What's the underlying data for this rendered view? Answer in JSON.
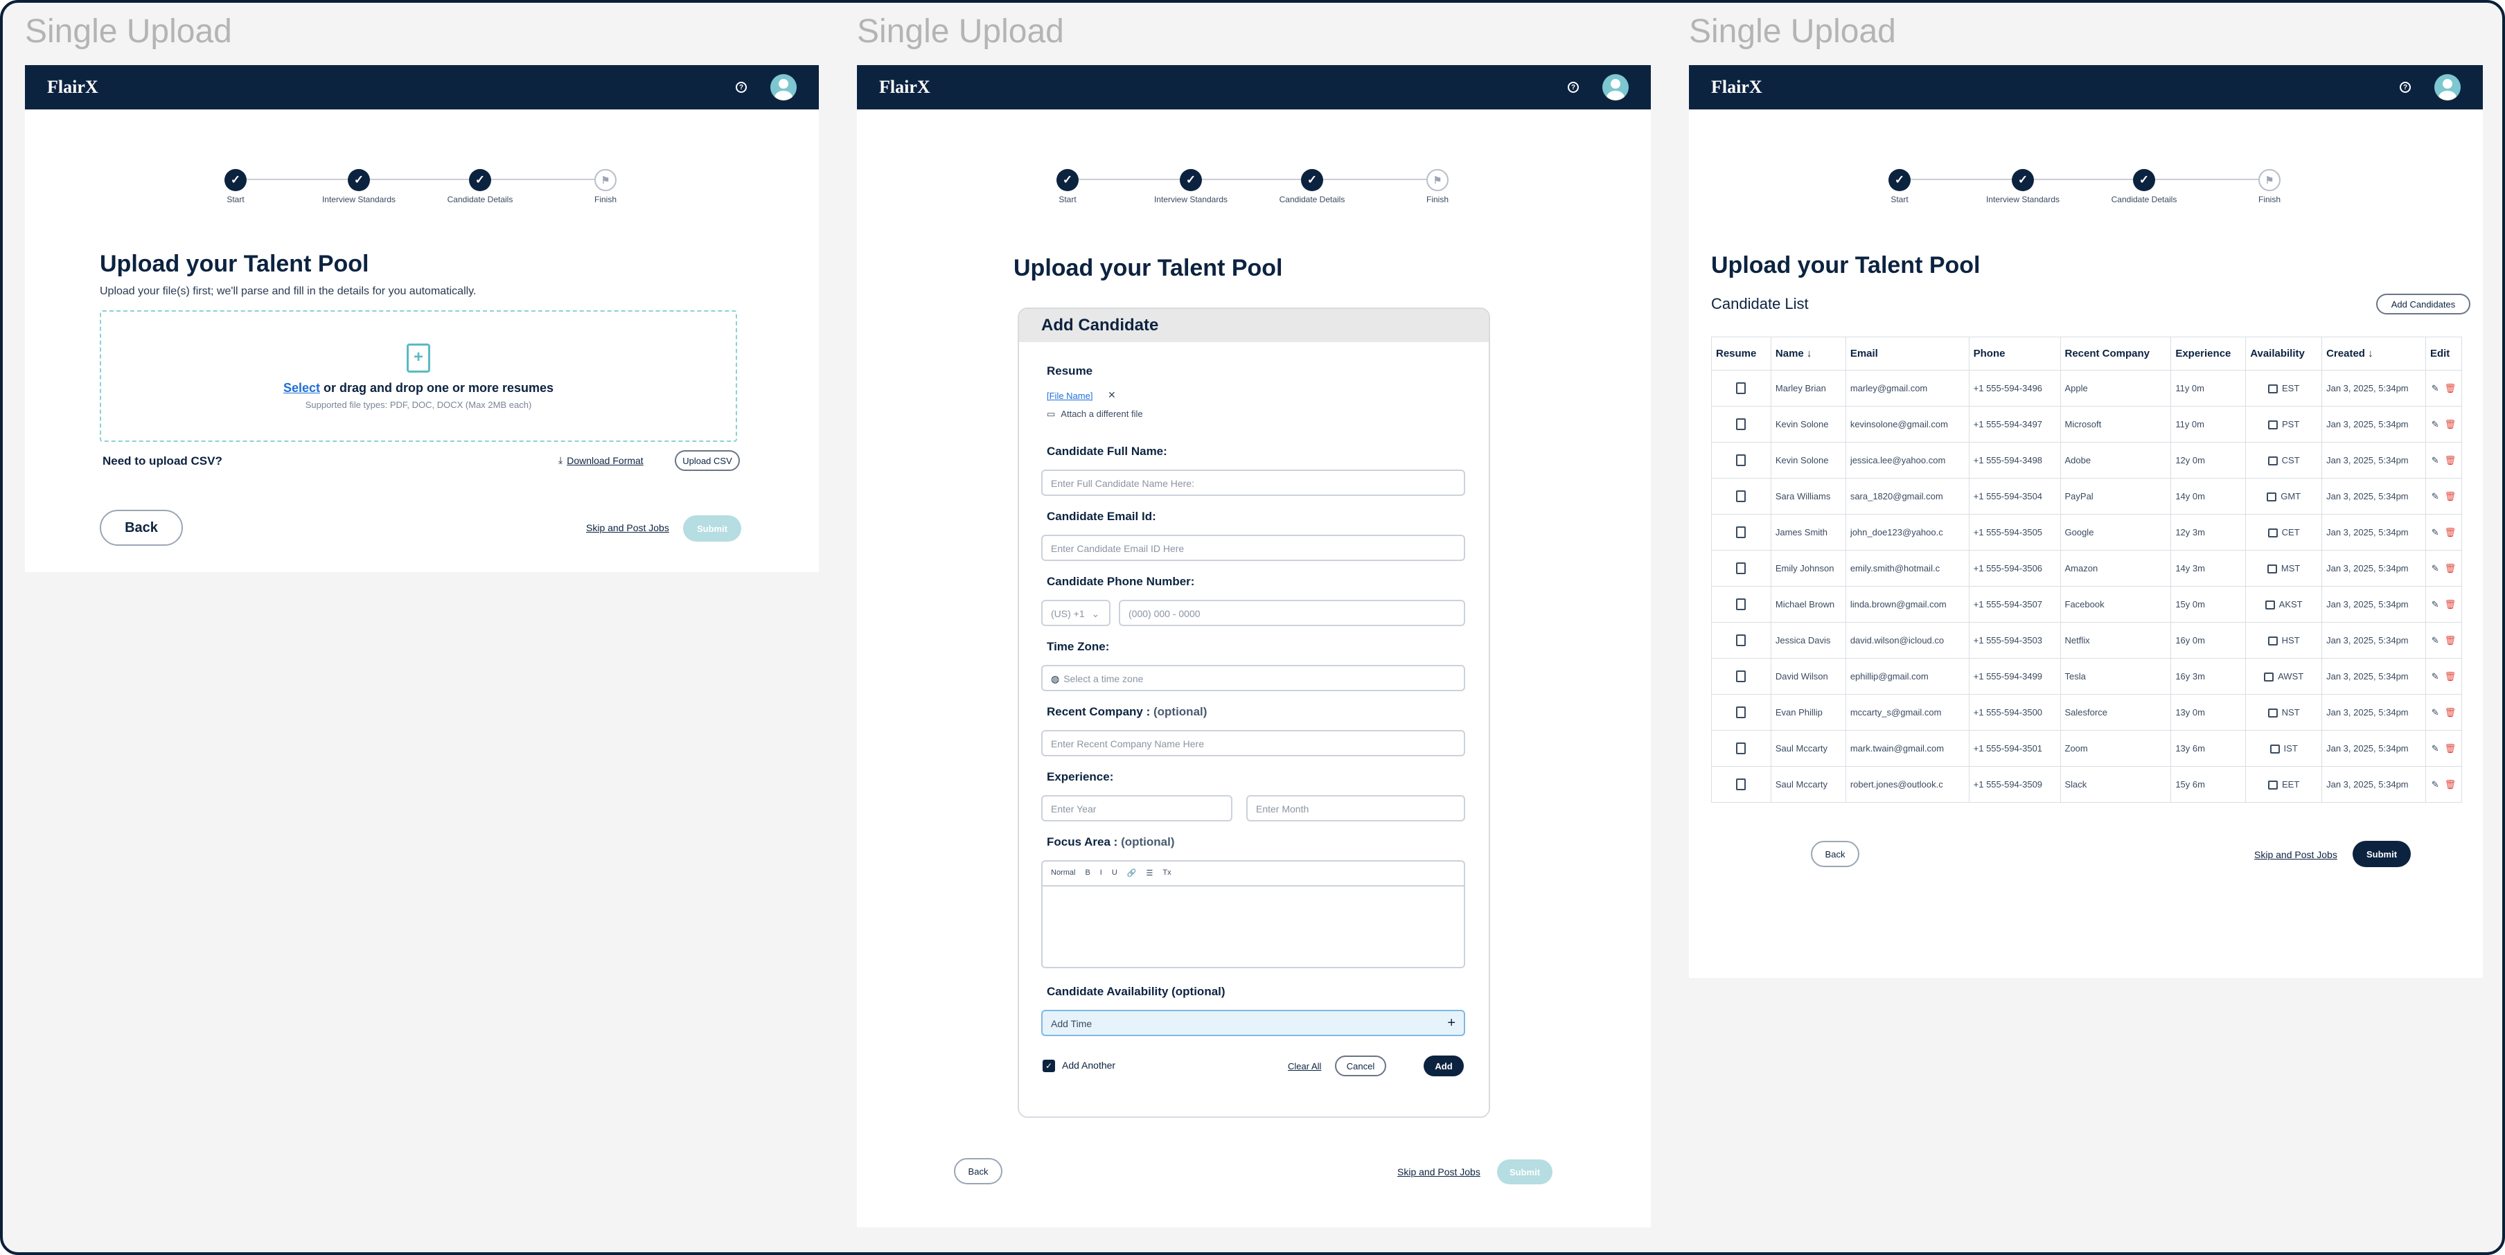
{
  "frame_label": "Single Upload",
  "logo": "FlairX",
  "help_glyph": "?",
  "steps": [
    {
      "label": "Start"
    },
    {
      "label": "Interview Standards"
    },
    {
      "label": "Candidate Details"
    },
    {
      "label": "Finish"
    }
  ],
  "page_title": "Upload your Talent Pool",
  "frame1": {
    "subtitle": "Upload your file(s) first; we'll parse and fill in the details for you automatically.",
    "select_link": "Select",
    "drop_text": " or drag and drop one or more resumes",
    "supported": "Supported file types: PDF, DOC, DOCX (Max 2MB each)",
    "csv_question": "Need to upload CSV?",
    "download_format": "Download Format",
    "upload_csv": "Upload CSV",
    "back": "Back",
    "skip": "Skip and Post Jobs",
    "submit": "Submit"
  },
  "frame2": {
    "card_title": "Add Candidate",
    "resume_label": "Resume",
    "file_name": "[File Name]",
    "attach_link": "Attach a different file",
    "full_name_label": "Candidate Full Name:",
    "full_name_placeholder": "Enter Full Candidate Name Here:",
    "email_label": "Candidate Email Id:",
    "email_placeholder": "Enter Candidate Email ID Here",
    "phone_label": "Candidate Phone Number:",
    "country_code": "(US) +1",
    "phone_placeholder": "(000) 000 - 0000",
    "tz_label": "Time Zone:",
    "tz_placeholder": "Select a time zone",
    "company_label": "Recent Company : ",
    "company_optional": "(optional)",
    "company_placeholder": "Enter Recent Company Name Here",
    "exp_label": "Experience:",
    "year_placeholder": "Enter Year",
    "month_placeholder": "Enter Month",
    "focus_label": "Focus Area : ",
    "focus_optional": "(optional)",
    "editor_tools": [
      "Normal",
      "B",
      "I",
      "U",
      "Tx"
    ],
    "availability_label": "Candidate Availability (optional)",
    "add_time": "Add Time",
    "add_another": "Add Another",
    "clear_all": "Clear All",
    "cancel": "Cancel",
    "add": "Add",
    "back": "Back",
    "skip": "Skip and Post Jobs",
    "submit": "Submit"
  },
  "frame3": {
    "list_title": "Candidate List",
    "add_candidates": "Add Candidates",
    "columns": [
      "Resume",
      "Name",
      "Email",
      "Phone",
      "Recent Company",
      "Experience",
      "Availability",
      "Created",
      "Edit"
    ],
    "rows": [
      {
        "name": "Marley Brian",
        "email": "marley@gmail.com",
        "phone": "+1 555-594-3496",
        "company": "Apple",
        "exp": "11y 0m",
        "tz": "EST",
        "created": "Jan 3, 2025, 5:34pm"
      },
      {
        "name": "Kevin Solone",
        "email": "kevinsolone@gmail.com",
        "phone": "+1 555-594-3497",
        "company": "Microsoft",
        "exp": "11y 0m",
        "tz": "PST",
        "created": "Jan 3, 2025, 5:34pm"
      },
      {
        "name": "Kevin Solone",
        "email": "jessica.lee@yahoo.com",
        "phone": "+1 555-594-3498",
        "company": "Adobe",
        "exp": "12y 0m",
        "tz": "CST",
        "created": "Jan 3, 2025, 5:34pm"
      },
      {
        "name": "Sara Williams",
        "email": "sara_1820@gmail.com",
        "phone": "+1 555-594-3504",
        "company": "PayPal",
        "exp": "14y 0m",
        "tz": "GMT",
        "created": "Jan 3, 2025, 5:34pm"
      },
      {
        "name": "James Smith",
        "email": "john_doe123@yahoo.c",
        "phone": "+1 555-594-3505",
        "company": "Google",
        "exp": "12y 3m",
        "tz": "CET",
        "created": "Jan 3, 2025, 5:34pm"
      },
      {
        "name": "Emily Johnson",
        "email": "emily.smith@hotmail.c",
        "phone": "+1 555-594-3506",
        "company": "Amazon",
        "exp": "14y 3m",
        "tz": "MST",
        "created": "Jan 3, 2025, 5:34pm"
      },
      {
        "name": "Michael Brown",
        "email": "linda.brown@gmail.com",
        "phone": "+1 555-594-3507",
        "company": "Facebook",
        "exp": "15y 0m",
        "tz": "AKST",
        "created": "Jan 3, 2025, 5:34pm"
      },
      {
        "name": "Jessica Davis",
        "email": "david.wilson@icloud.co",
        "phone": "+1 555-594-3503",
        "company": "Netflix",
        "exp": "16y 0m",
        "tz": "HST",
        "created": "Jan 3, 2025, 5:34pm"
      },
      {
        "name": "David Wilson",
        "email": "ephillip@gmail.com",
        "phone": "+1 555-594-3499",
        "company": "Tesla",
        "exp": "16y 3m",
        "tz": "AWST",
        "created": "Jan 3, 2025, 5:34pm"
      },
      {
        "name": "Evan Phillip",
        "email": "mccarty_s@gmail.com",
        "phone": "+1 555-594-3500",
        "company": "Salesforce",
        "exp": "13y 0m",
        "tz": "NST",
        "created": "Jan 3, 2025, 5:34pm"
      },
      {
        "name": "Saul Mccarty",
        "email": "mark.twain@gmail.com",
        "phone": "+1 555-594-3501",
        "company": "Zoom",
        "exp": "13y 6m",
        "tz": "IST",
        "created": "Jan 3, 2025, 5:34pm"
      },
      {
        "name": "Saul Mccarty",
        "email": "robert.jones@outlook.c",
        "phone": "+1 555-594-3509",
        "company": "Slack",
        "exp": "15y 6m",
        "tz": "EET",
        "created": "Jan 3, 2025, 5:34pm"
      }
    ],
    "back": "Back",
    "skip": "Skip and Post Jobs",
    "submit": "Submit"
  },
  "colors": {
    "navy": "#0c2340",
    "teal": "#5bbac4",
    "submit_disabled": "#b5dde2",
    "delete": "#e0453a"
  }
}
